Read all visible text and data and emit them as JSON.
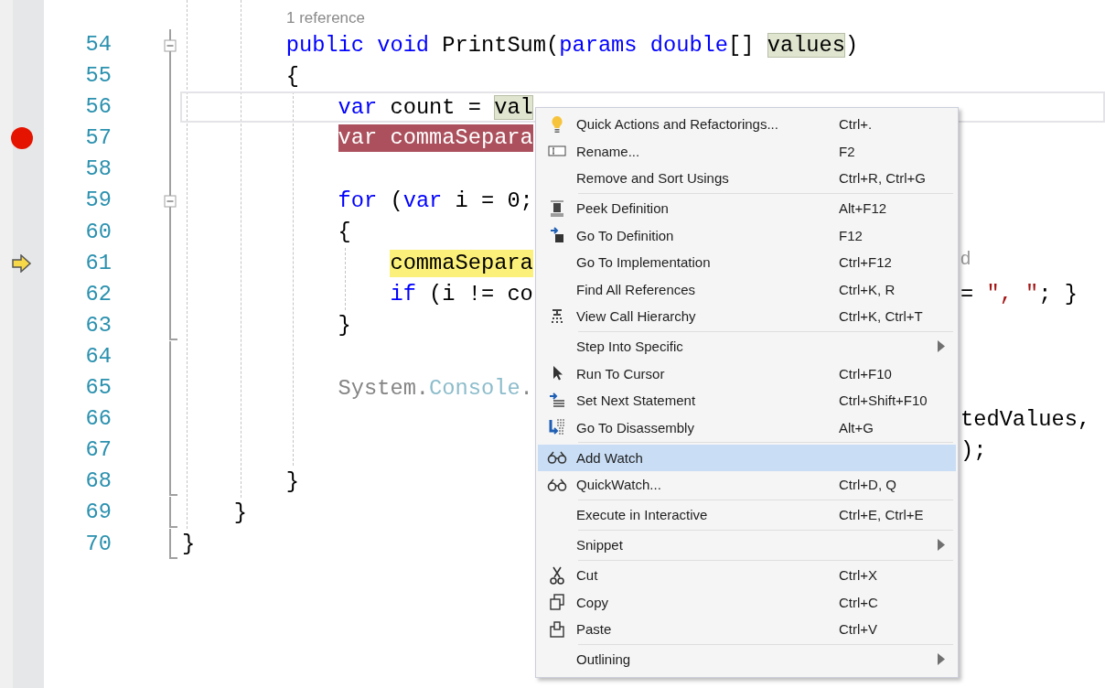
{
  "editor": {
    "codelens": "1 reference",
    "lines": [
      {
        "number": "54",
        "collapsible": true,
        "block_end": false,
        "breakpoint": false,
        "execution": false,
        "caret": false,
        "code": [
          {
            "kind": "keyword",
            "text": "        public void"
          },
          {
            "kind": "plain",
            "text": " PrintSum("
          },
          {
            "kind": "keyword",
            "text": "params double"
          },
          {
            "kind": "plain",
            "text": "[] "
          },
          {
            "kind": "reference",
            "text": "values"
          },
          {
            "kind": "plain",
            "text": ")"
          }
        ]
      },
      {
        "number": "55",
        "collapsible": false,
        "block_end": false,
        "breakpoint": false,
        "execution": false,
        "caret": false,
        "code": [
          {
            "kind": "plain",
            "text": "        {"
          }
        ]
      },
      {
        "number": "56",
        "collapsible": false,
        "block_end": false,
        "breakpoint": false,
        "execution": false,
        "caret": true,
        "code": [
          {
            "kind": "keyword",
            "text": "            var"
          },
          {
            "kind": "plain",
            "text": " count = "
          },
          {
            "kind": "reference",
            "text": "val"
          }
        ]
      },
      {
        "number": "57",
        "collapsible": false,
        "block_end": false,
        "breakpoint": true,
        "execution": false,
        "caret": false,
        "code": [
          {
            "kind": "breakpoint",
            "text": "            var commaSepara"
          }
        ]
      },
      {
        "number": "58",
        "collapsible": false,
        "block_end": false,
        "breakpoint": false,
        "execution": false,
        "caret": false
      },
      {
        "number": "59",
        "collapsible": true,
        "block_end": false,
        "breakpoint": false,
        "execution": false,
        "caret": false,
        "code": [
          {
            "kind": "keyword",
            "text": "            for"
          },
          {
            "kind": "plain",
            "text": " ("
          },
          {
            "kind": "keyword",
            "text": "var"
          },
          {
            "kind": "plain",
            "text": " i = 0;"
          }
        ]
      },
      {
        "number": "60",
        "collapsible": false,
        "block_end": false,
        "breakpoint": false,
        "execution": false,
        "caret": false,
        "code": [
          {
            "kind": "plain",
            "text": "            {"
          }
        ]
      },
      {
        "number": "61",
        "collapsible": false,
        "block_end": false,
        "breakpoint": false,
        "execution": true,
        "caret": false,
        "code": [
          {
            "kind": "current",
            "text": "                commaSepara"
          }
        ],
        "overflow": [
          {
            "kind": "faded",
            "text": "d"
          }
        ]
      },
      {
        "number": "62",
        "collapsible": false,
        "block_end": false,
        "breakpoint": false,
        "execution": false,
        "caret": false,
        "code": [
          {
            "kind": "keyword",
            "text": "                if"
          },
          {
            "kind": "plain",
            "text": " (i != co"
          }
        ],
        "overflow": [
          {
            "kind": "plain",
            "text": "= "
          },
          {
            "kind": "string",
            "text": "\", \""
          },
          {
            "kind": "plain",
            "text": "; }"
          }
        ]
      },
      {
        "number": "63",
        "collapsible": false,
        "block_end": true,
        "breakpoint": false,
        "execution": false,
        "caret": false,
        "code": [
          {
            "kind": "plain",
            "text": "            }"
          }
        ]
      },
      {
        "number": "64",
        "collapsible": false,
        "block_end": false,
        "breakpoint": false,
        "execution": false,
        "caret": false
      },
      {
        "number": "65",
        "collapsible": false,
        "block_end": false,
        "breakpoint": false,
        "execution": false,
        "caret": false,
        "code": [
          {
            "kind": "dim",
            "text": "            System."
          },
          {
            "kind": "dimtype",
            "text": "Console"
          },
          {
            "kind": "dim",
            "text": "."
          }
        ]
      },
      {
        "number": "66",
        "collapsible": false,
        "block_end": false,
        "breakpoint": false,
        "execution": false,
        "caret": false,
        "overflow": [
          {
            "kind": "plain",
            "text": "tedValues,"
          }
        ]
      },
      {
        "number": "67",
        "collapsible": false,
        "block_end": false,
        "breakpoint": false,
        "execution": false,
        "caret": false,
        "overflow": [
          {
            "kind": "plain",
            "text": ");"
          }
        ]
      },
      {
        "number": "68",
        "collapsible": false,
        "block_end": true,
        "breakpoint": false,
        "execution": false,
        "caret": false,
        "code": [
          {
            "kind": "plain",
            "text": "        }"
          }
        ]
      },
      {
        "number": "69",
        "collapsible": false,
        "block_end": true,
        "breakpoint": false,
        "execution": false,
        "caret": false,
        "code": [
          {
            "kind": "plain",
            "text": "    }"
          }
        ]
      },
      {
        "number": "70",
        "collapsible": false,
        "block_end": true,
        "breakpoint": false,
        "execution": false,
        "caret": false,
        "code": [
          {
            "kind": "plain",
            "text": "}"
          }
        ]
      }
    ]
  },
  "context_menu": {
    "groups": [
      [
        {
          "label": "Quick Actions and Refactorings...",
          "shortcut": "Ctrl+.",
          "submenu": false,
          "selected": false
        },
        {
          "label": "Rename...",
          "shortcut": "F2",
          "submenu": false,
          "selected": false
        },
        {
          "label": "Remove and Sort Usings",
          "shortcut": "Ctrl+R, Ctrl+G",
          "submenu": false,
          "selected": false
        }
      ],
      [
        {
          "label": "Peek Definition",
          "shortcut": "Alt+F12",
          "submenu": false,
          "selected": false
        },
        {
          "label": "Go To Definition",
          "shortcut": "F12",
          "submenu": false,
          "selected": false
        },
        {
          "label": "Go To Implementation",
          "shortcut": "Ctrl+F12",
          "submenu": false,
          "selected": false
        },
        {
          "label": "Find All References",
          "shortcut": "Ctrl+K, R",
          "submenu": false,
          "selected": false
        },
        {
          "label": "View Call Hierarchy",
          "shortcut": "Ctrl+K, Ctrl+T",
          "submenu": false,
          "selected": false
        }
      ],
      [
        {
          "label": "Step Into Specific",
          "submenu": true,
          "selected": false
        },
        {
          "label": "Run To Cursor",
          "shortcut": "Ctrl+F10",
          "submenu": false,
          "selected": false
        },
        {
          "label": "Set Next Statement",
          "shortcut": "Ctrl+Shift+F10",
          "submenu": false,
          "selected": false
        },
        {
          "label": "Go To Disassembly",
          "shortcut": "Alt+G",
          "submenu": false,
          "selected": false
        }
      ],
      [
        {
          "label": "Add Watch",
          "submenu": false,
          "selected": true
        },
        {
          "label": "QuickWatch...",
          "shortcut": "Ctrl+D, Q",
          "submenu": false,
          "selected": false
        }
      ],
      [
        {
          "label": "Execute in Interactive",
          "shortcut": "Ctrl+E, Ctrl+E",
          "submenu": false,
          "selected": false
        }
      ],
      [
        {
          "label": "Snippet",
          "submenu": true,
          "selected": false
        }
      ],
      [
        {
          "label": "Cut",
          "shortcut": "Ctrl+X",
          "submenu": false,
          "selected": false
        },
        {
          "label": "Copy",
          "shortcut": "Ctrl+C",
          "submenu": false,
          "selected": false
        },
        {
          "label": "Paste",
          "shortcut": "Ctrl+V",
          "submenu": false,
          "selected": false
        }
      ],
      [
        {
          "label": "Outlining",
          "submenu": true,
          "selected": false
        }
      ]
    ]
  }
}
